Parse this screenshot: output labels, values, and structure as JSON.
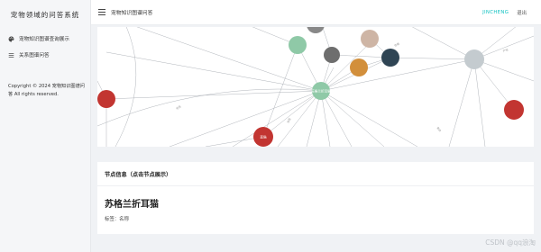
{
  "app": {
    "title": "宠物领域的问答系统"
  },
  "sidebar": {
    "items": [
      {
        "label": "宠物知识图谱查询展示",
        "icon": "palette-icon"
      },
      {
        "label": "关系图谱问答",
        "icon": "list-icon"
      }
    ],
    "copyright": "Copyright © 2024 宠物知识图谱问答 All rights reserved."
  },
  "header": {
    "page_title": "宠物知识图谱问答",
    "user": "JINCHENG",
    "logout": "退出"
  },
  "graph": {
    "nodes": [
      {
        "id": "n1",
        "label": "苏格兰折耳猫",
        "color": "#8fc9a7"
      },
      {
        "id": "n2",
        "label": "",
        "color": "#c23531"
      },
      {
        "id": "n3",
        "label": "",
        "color": "#c23531"
      },
      {
        "id": "n4",
        "label": "蓝猫",
        "color": "#c23531"
      },
      {
        "id": "n5",
        "label": "",
        "color": "#888888"
      },
      {
        "id": "n6",
        "label": "",
        "color": "#8fc9a7"
      },
      {
        "id": "n7",
        "label": "",
        "color": "#6e6e6e"
      },
      {
        "id": "n8",
        "label": "",
        "color": "#ceb5a5"
      },
      {
        "id": "n9",
        "label": "",
        "color": "#d28f3b"
      },
      {
        "id": "n10",
        "label": "",
        "color": "#2f4554"
      },
      {
        "id": "n11",
        "label": "",
        "color": "#c4cbcf"
      },
      {
        "id": "n12",
        "label": "",
        "color": "#c23531"
      }
    ],
    "edge_labels": [
      "毛色",
      "体型",
      "性格",
      "产地",
      "寿命"
    ]
  },
  "info": {
    "header": "节点信息（点击节点展示）",
    "node_name": "苏格兰折耳猫",
    "tags": "标签：名称"
  },
  "watermark": "CSDN @qq浪淘"
}
